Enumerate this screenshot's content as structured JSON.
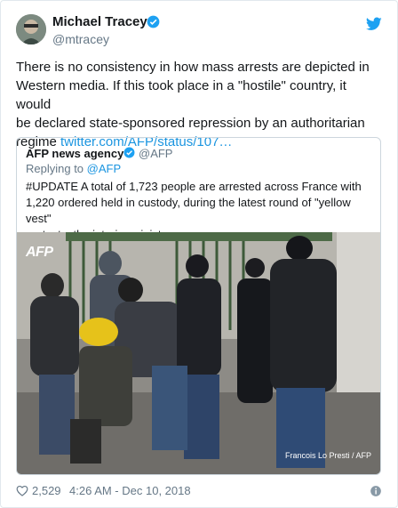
{
  "author": {
    "name": "Michael Tracey",
    "handle": "@mtracey",
    "verified_icon": "verified-badge-icon"
  },
  "tweet": {
    "text_lines": [
      "There is no consistency in how mass arrests are depicted in",
      "Western media. If this took place in a \"hostile\" country, it would",
      "be declared state-sponsored repression by an authoritarian",
      "regime "
    ],
    "link": "twitter.com/AFP/status/107…"
  },
  "quoted": {
    "name": "AFP news agency",
    "handle": "@AFP",
    "reply_prefix": "Replying to ",
    "reply_to": "@AFP",
    "text_lines": [
      "#UPDATE A total of 1,723 people are arrested across France with",
      "1,220 ordered held in custody, during the latest round of \"yellow vest\"",
      "protests, the interior ministry says"
    ],
    "photo": {
      "logo": "AFP",
      "credit": "Francois Lo Presti / AFP"
    }
  },
  "footer": {
    "likes": "2,529",
    "timestamp": "4:26 AM - Dec 10, 2018"
  },
  "colors": {
    "link": "#1b95e0",
    "muted": "#657786",
    "text": "#14171a",
    "twitter_blue": "#1da1f2"
  }
}
